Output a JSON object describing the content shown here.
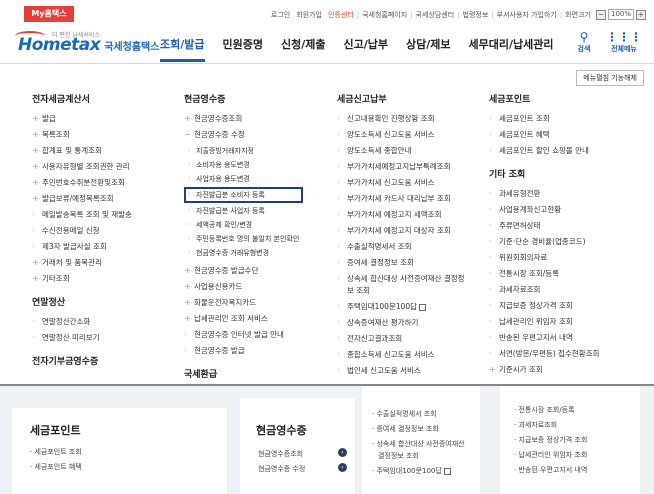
{
  "topbar": {
    "myhome": "My홈택스",
    "links": [
      "로그인",
      "회원가입",
      "인증센터",
      "국세청홈페이지",
      "국세상담센터",
      "법령정보",
      "부서사용자 가입하기"
    ],
    "zoom_label": "화면크기",
    "zoom_value": "100%"
  },
  "header": {
    "logo_text": "Hometax",
    "logo_name": "국세청홈택스",
    "logo_sub": "더 편한 납세서비스",
    "nav": [
      "조회/발급",
      "민원증명",
      "신청/제출",
      "신고/납부",
      "상담/제보",
      "세무대리/납세관리"
    ],
    "search_label": "검색",
    "allmenu_label": "전체메뉴",
    "menu_fix": "메뉴펼침 기능해제"
  },
  "mega": {
    "col1": {
      "title": "전자세금계산서",
      "items": [
        "발급",
        "목록조회",
        "합계표 및 통계조회",
        "사용자유형별 조회권한 관리",
        "주민번호수취분전환및조회",
        "발급보류/예정목록조회",
        "메일발송목록 조회 및 재발송",
        "수신전용메일 신청",
        "제3자 발급사실 조회",
        "거래처 및 품목관리",
        "기타조회"
      ],
      "title2": "연말정산",
      "items2": [
        "연말정산간소화",
        "연말정산 미리보기"
      ],
      "title3": "전자기부금영수증"
    },
    "col2": {
      "title": "현금영수증",
      "items": [
        "현금영수증조회",
        "현금영수증 수정"
      ],
      "sub": [
        "지출증빙거래자지정",
        "소비자용 용도변경",
        "사업자용 용도변경",
        "자진발급분 소비자 등록",
        "자진발급분 사업자 등록",
        "세액공제 확인/변경",
        "주민등록번호 명의 불일치 본인확인",
        "현금영수증 거래유형변경"
      ],
      "items2": [
        "현금영수증 발급수단",
        "사업용신용카드",
        "화물운전자복지카드",
        "납세관리인 조회 서비스",
        "현금영수증 인터넷 발급 안내",
        "현금영수증 발급"
      ],
      "title2": "국세환급"
    },
    "col3": {
      "title": "세금신고납부",
      "items": [
        "신고내용확인 진행상황 조회",
        "양도소득세 신고도움 서비스",
        "양도소득세 종합안내",
        "부가가치세예정고지납부특례조회",
        "부가가치세 신고도움 서비스",
        "부가가치세 카드사 대리납부 조회",
        "부가가치세 예정고지 세액조회",
        "부가가치세 예정고지 대상자 조회",
        "수출실적명세서 조회",
        "증여세 결정정보 조회",
        "상속세 합산대상 사전증여재산 결정정",
        "보 조회",
        "주택임대100문100답",
        "상속증여재산 평가하기",
        "전자신고결과조회",
        "종합소득세 신고도움 서비스",
        "법인세 신고도움 서비스"
      ]
    },
    "col4": {
      "title": "세금포인트",
      "items": [
        "세금포인트 조회",
        "세금포인트 혜택",
        "세금포인트 할인 쇼핑몰 안내"
      ],
      "title2": "기타 조회",
      "items2": [
        "과세유형전환",
        "사업용계좌신고현황",
        "주류면허상태",
        "기준·단순 경비율(업종코드)",
        "위원회회의자료",
        "전통시장 조회/등록",
        "과세자료조회",
        "지급보증 정상가격 조회",
        "납세관리인 위임자 조회",
        "반송된 우편고지서 내역",
        "서면(방문/우편등) 접수현황조회",
        "기준시가 조회"
      ]
    }
  },
  "bottom": {
    "left_title": "세금포인트",
    "left_items": [
      "세금포인트 조회",
      "세금포인트 혜택"
    ],
    "mid_title": "현금영수증",
    "mid_items": [
      "현금영수증조회",
      "현금영수증 수정"
    ],
    "mid2_items": [
      "수출실적명세서 조회",
      "증여세 결정정보 조회",
      "상속세 합산대상 사전증여재산",
      "결정정보 조회",
      "주택임대100문100답"
    ],
    "right_items": [
      "전통시장 조회/등록",
      "과세자료조회",
      "지급보증 정상가격 조회",
      "납세관리인 위임자 조회",
      "반송된 우편고지서 내역"
    ]
  }
}
